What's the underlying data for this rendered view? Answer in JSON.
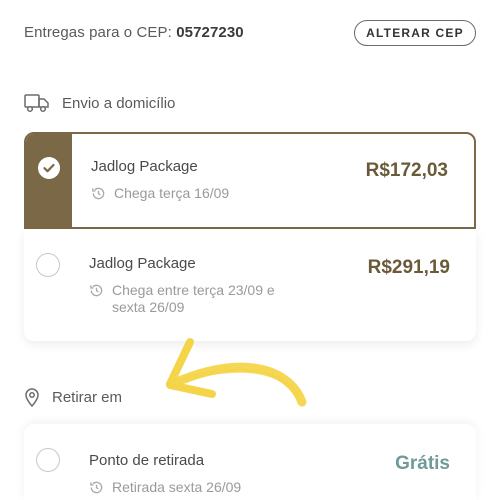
{
  "shipping": {
    "cep_label": "Entregas para o CEP: ",
    "cep_value": "05727230",
    "change_button": "ALTERAR CEP"
  },
  "home_delivery": {
    "heading": "Envio a domicílio",
    "icon": "truck-icon",
    "options": [
      {
        "title": "Jadlog Package",
        "eta": "Chega terça 16/09",
        "price": "R$172,03",
        "selected": true
      },
      {
        "title": "Jadlog Package",
        "eta": "Chega entre terça 23/09 e sexta 26/09",
        "price": "R$291,19",
        "selected": false
      }
    ]
  },
  "pickup": {
    "heading": "Retirar em",
    "icon": "map-pin-icon",
    "options": [
      {
        "title": "Ponto de retirada",
        "eta": "Retirada sexta 26/09",
        "price": "Grátis",
        "selected": false
      }
    ]
  },
  "colors": {
    "accent": "#7a6846",
    "price": "#6b5a3a",
    "free": "#6f9a9a",
    "annotation_arrow": "#f4d54a"
  },
  "annotation": {
    "icon": "yellow-arrow-annotation"
  }
}
